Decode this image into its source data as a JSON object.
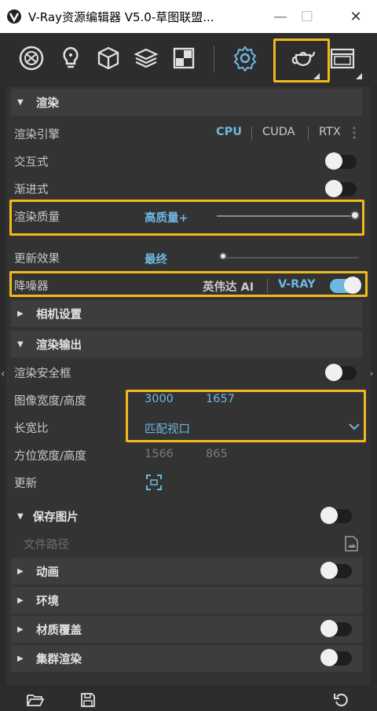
{
  "window": {
    "title": "V-Ray资源编辑器 V5.0-草图联盟..."
  },
  "sections": {
    "render": "渲染",
    "camera": "相机设置",
    "render_output": "渲染输出",
    "save_image": "保存图片",
    "animation": "动画",
    "environment": "环境",
    "material_override": "材质覆盖",
    "swarm": "集群渲染"
  },
  "render": {
    "engine_label": "渲染引擎",
    "engine_options": [
      "CPU",
      "CUDA",
      "RTX"
    ],
    "engine_selected": "CPU",
    "interactive_label": "交互式",
    "progressive_label": "渐进式",
    "quality_label": "渲染质量",
    "quality_value": "高质量+",
    "quality_level": 1.0,
    "update_label": "更新效果",
    "update_value": "最终",
    "update_level": 0.0,
    "denoiser_label": "降噪器",
    "denoiser_options": [
      "英伟达 AI",
      "V-RAY"
    ],
    "denoiser_selected": "V-RAY",
    "denoiser_on": true
  },
  "output": {
    "safe_frame_label": "渲染安全框",
    "image_size_label": "图像宽度/高度",
    "width": "3000",
    "height": "1657",
    "aspect_label": "长宽比",
    "aspect_value": "匹配视口",
    "orient_label": "方位宽度/高度",
    "orient_width": "1566",
    "orient_height": "865",
    "update_label": "更新"
  },
  "save": {
    "path_placeholder": "文件路径"
  },
  "colors": {
    "accent": "#6fb6e0",
    "highlight": "#f3b81e",
    "panel": "#333333"
  }
}
